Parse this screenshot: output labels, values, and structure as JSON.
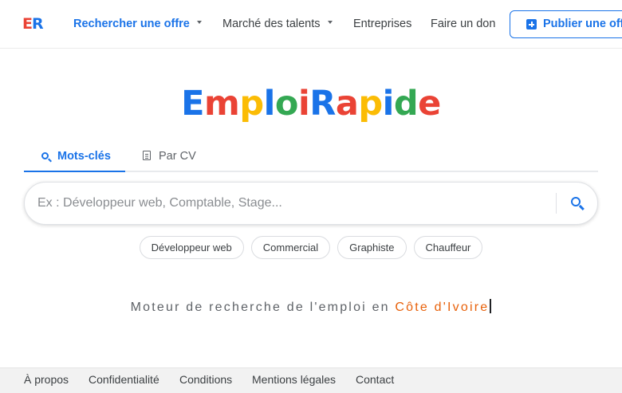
{
  "header": {
    "logo_letters": [
      {
        "char": "E",
        "color": "#ea4335"
      },
      {
        "char": "R",
        "color": "#1a73e8"
      }
    ],
    "nav": [
      {
        "label": "Rechercher une offre",
        "active": true,
        "has_caret": true
      },
      {
        "label": "Marché des talents",
        "active": false,
        "has_caret": true
      },
      {
        "label": "Entreprises",
        "active": false,
        "has_caret": false
      },
      {
        "label": "Faire un don",
        "active": false,
        "has_caret": false
      }
    ],
    "publish_button": {
      "label": "Publier une offre",
      "icon": "plus-square-icon"
    }
  },
  "brand": {
    "letters": [
      {
        "char": "E",
        "color": "#1a73e8"
      },
      {
        "char": "m",
        "color": "#ea4335"
      },
      {
        "char": "p",
        "color": "#fbbc05"
      },
      {
        "char": "l",
        "color": "#1a73e8"
      },
      {
        "char": "o",
        "color": "#34a853"
      },
      {
        "char": "i",
        "color": "#ea4335"
      },
      {
        "char": "R",
        "color": "#1a73e8"
      },
      {
        "char": "a",
        "color": "#ea4335"
      },
      {
        "char": "p",
        "color": "#fbbc05"
      },
      {
        "char": "i",
        "color": "#1a73e8"
      },
      {
        "char": "d",
        "color": "#34a853"
      },
      {
        "char": "e",
        "color": "#ea4335"
      }
    ]
  },
  "tabs": [
    {
      "label": "Mots-clés",
      "icon": "search-icon",
      "active": true
    },
    {
      "label": "Par CV",
      "icon": "document-icon",
      "active": false
    }
  ],
  "search": {
    "value": "",
    "placeholder": "Ex : Développeur web, Comptable, Stage...",
    "button_icon": "search-icon"
  },
  "suggestions": [
    "Développeur web",
    "Commercial",
    "Graphiste",
    "Chauffeur"
  ],
  "tagline": {
    "prefix": "Moteur de recherche de l'emploi en ",
    "country": "Côte d'Ivoire",
    "country_color": "#e8620c"
  },
  "footer": {
    "links": [
      "À propos",
      "Confidentialité",
      "Conditions",
      "Mentions légales",
      "Contact"
    ]
  },
  "colors": {
    "accent": "#1a73e8"
  }
}
